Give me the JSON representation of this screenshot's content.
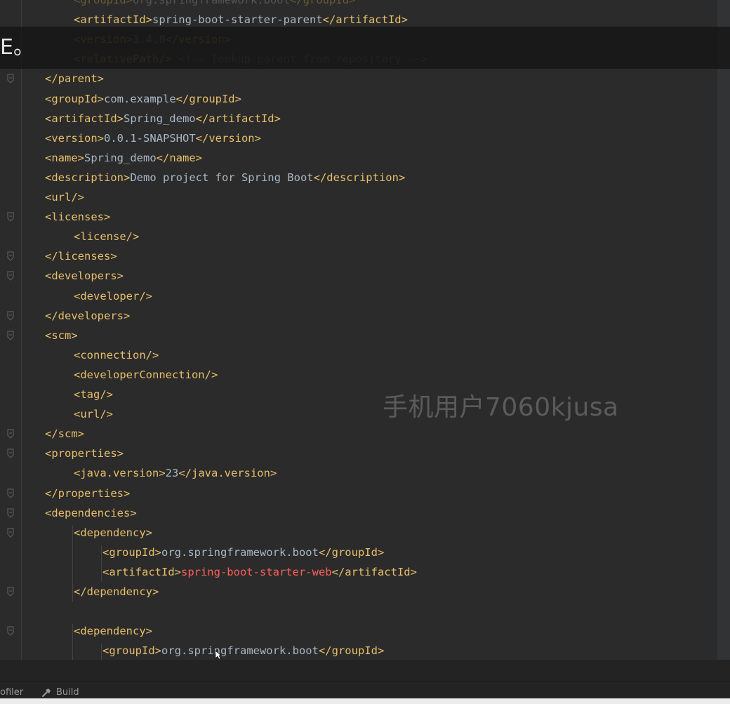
{
  "editor": {
    "lines": [
      {
        "indent": 2,
        "fold": false,
        "fade": true,
        "tokens": [
          {
            "c": "tag",
            "t": "<groupId>"
          },
          {
            "c": "txt",
            "t": "org.springframework.boot"
          },
          {
            "c": "tag",
            "t": "</groupId>"
          }
        ]
      },
      {
        "indent": 2,
        "fold": false,
        "fade": false,
        "tokens": [
          {
            "c": "tag",
            "t": "<artifactId>"
          },
          {
            "c": "txt",
            "t": "spring-boot-starter-parent"
          },
          {
            "c": "tag",
            "t": "</artifactId>"
          }
        ]
      },
      {
        "indent": 2,
        "fold": false,
        "fade": true,
        "tokens": [
          {
            "c": "tag",
            "t": "<version>"
          },
          {
            "c": "txt",
            "t": "3.4.0"
          },
          {
            "c": "tag",
            "t": "</version>"
          }
        ]
      },
      {
        "indent": 2,
        "fold": false,
        "fade": true,
        "tokens": [
          {
            "c": "tag",
            "t": "<relativePath/>"
          },
          {
            "c": "cmt",
            "t": " <!-- lookup parent from repository -->"
          }
        ]
      },
      {
        "indent": 1,
        "fold": true,
        "fade": false,
        "tokens": [
          {
            "c": "tag",
            "t": "</parent>"
          }
        ]
      },
      {
        "indent": 1,
        "fold": false,
        "fade": false,
        "tokens": [
          {
            "c": "tag",
            "t": "<groupId>"
          },
          {
            "c": "txt",
            "t": "com.example"
          },
          {
            "c": "tag",
            "t": "</groupId>"
          }
        ]
      },
      {
        "indent": 1,
        "fold": false,
        "fade": false,
        "tokens": [
          {
            "c": "tag",
            "t": "<artifactId>"
          },
          {
            "c": "txt",
            "t": "Spring_demo"
          },
          {
            "c": "tag",
            "t": "</artifactId>"
          }
        ]
      },
      {
        "indent": 1,
        "fold": false,
        "fade": false,
        "tokens": [
          {
            "c": "tag",
            "t": "<version>"
          },
          {
            "c": "txt",
            "t": "0.0.1-SNAPSHOT"
          },
          {
            "c": "tag",
            "t": "</version>"
          }
        ]
      },
      {
        "indent": 1,
        "fold": false,
        "fade": false,
        "tokens": [
          {
            "c": "tag",
            "t": "<name>"
          },
          {
            "c": "txt",
            "t": "Spring_demo"
          },
          {
            "c": "tag",
            "t": "</name>"
          }
        ]
      },
      {
        "indent": 1,
        "fold": false,
        "fade": false,
        "tokens": [
          {
            "c": "tag",
            "t": "<description>"
          },
          {
            "c": "txt",
            "t": "Demo project for Spring Boot"
          },
          {
            "c": "tag",
            "t": "</description>"
          }
        ]
      },
      {
        "indent": 1,
        "fold": false,
        "fade": false,
        "tokens": [
          {
            "c": "tag",
            "t": "<url/>"
          }
        ]
      },
      {
        "indent": 1,
        "fold": true,
        "fade": false,
        "tokens": [
          {
            "c": "tag",
            "t": "<licenses>"
          }
        ]
      },
      {
        "indent": 2,
        "fold": false,
        "fade": false,
        "tokens": [
          {
            "c": "tag",
            "t": "<license/>"
          }
        ]
      },
      {
        "indent": 1,
        "fold": true,
        "fade": false,
        "tokens": [
          {
            "c": "tag",
            "t": "</licenses>"
          }
        ]
      },
      {
        "indent": 1,
        "fold": true,
        "fade": false,
        "tokens": [
          {
            "c": "tag",
            "t": "<developers>"
          }
        ]
      },
      {
        "indent": 2,
        "fold": false,
        "fade": false,
        "tokens": [
          {
            "c": "tag",
            "t": "<developer/>"
          }
        ]
      },
      {
        "indent": 1,
        "fold": true,
        "fade": false,
        "tokens": [
          {
            "c": "tag",
            "t": "</developers>"
          }
        ]
      },
      {
        "indent": 1,
        "fold": true,
        "fade": false,
        "tokens": [
          {
            "c": "tag",
            "t": "<scm>"
          }
        ]
      },
      {
        "indent": 2,
        "fold": false,
        "fade": false,
        "tokens": [
          {
            "c": "tag",
            "t": "<connection/>"
          }
        ]
      },
      {
        "indent": 2,
        "fold": false,
        "fade": false,
        "tokens": [
          {
            "c": "tag",
            "t": "<developerConnection/>"
          }
        ]
      },
      {
        "indent": 2,
        "fold": false,
        "fade": false,
        "tokens": [
          {
            "c": "tag",
            "t": "<tag/>"
          }
        ]
      },
      {
        "indent": 2,
        "fold": false,
        "fade": false,
        "tokens": [
          {
            "c": "tag",
            "t": "<url/>"
          }
        ]
      },
      {
        "indent": 1,
        "fold": true,
        "fade": false,
        "tokens": [
          {
            "c": "tag",
            "t": "</scm>"
          }
        ]
      },
      {
        "indent": 1,
        "fold": true,
        "fade": false,
        "tokens": [
          {
            "c": "tag",
            "t": "<properties>"
          }
        ]
      },
      {
        "indent": 2,
        "fold": false,
        "fade": false,
        "tokens": [
          {
            "c": "tag",
            "t": "<java.version>"
          },
          {
            "c": "txt",
            "t": "23"
          },
          {
            "c": "tag",
            "t": "</java.version>"
          }
        ]
      },
      {
        "indent": 1,
        "fold": true,
        "fade": false,
        "tokens": [
          {
            "c": "tag",
            "t": "</properties>"
          }
        ]
      },
      {
        "indent": 1,
        "fold": true,
        "fade": false,
        "tokens": [
          {
            "c": "tag",
            "t": "<dependencies>"
          }
        ]
      },
      {
        "indent": 2,
        "fold": true,
        "fade": false,
        "tokens": [
          {
            "c": "tag",
            "t": "<dependency>"
          }
        ]
      },
      {
        "indent": 3,
        "fold": false,
        "fade": false,
        "tokens": [
          {
            "c": "tag",
            "t": "<groupId>"
          },
          {
            "c": "txt",
            "t": "org.springframework.boot"
          },
          {
            "c": "tag",
            "t": "</groupId>"
          }
        ]
      },
      {
        "indent": 3,
        "fold": false,
        "fade": false,
        "tokens": [
          {
            "c": "tag",
            "t": "<artifactId>"
          },
          {
            "c": "red",
            "t": "spring-boot-starter-web"
          },
          {
            "c": "tag",
            "t": "</artifactId>"
          }
        ]
      },
      {
        "indent": 2,
        "fold": true,
        "fade": false,
        "tokens": [
          {
            "c": "tag",
            "t": "</dependency>"
          }
        ]
      },
      {
        "indent": 0,
        "fold": false,
        "fade": false,
        "tokens": []
      },
      {
        "indent": 2,
        "fold": true,
        "fade": false,
        "tokens": [
          {
            "c": "tag",
            "t": "<dependency>"
          }
        ]
      },
      {
        "indent": 3,
        "fold": false,
        "fade": false,
        "tokens": [
          {
            "c": "tag",
            "t": "<groupId>"
          },
          {
            "c": "txt",
            "t": "org.springframework.boot"
          },
          {
            "c": "tag",
            "t": "</groupId>"
          }
        ]
      }
    ]
  },
  "overlay": {
    "char": "E。"
  },
  "watermark": "手机用户7060kjusa",
  "bottom_toolbar": {
    "tabs": [
      {
        "label": "ofiler"
      },
      {
        "label": "Build",
        "icon": "hammer-icon"
      }
    ]
  },
  "colors": {
    "background": "#2b2b2b",
    "tag": "#e8bf6a",
    "text": "#a9b7c6",
    "comment": "#808080",
    "error": "#ff5f5a"
  }
}
